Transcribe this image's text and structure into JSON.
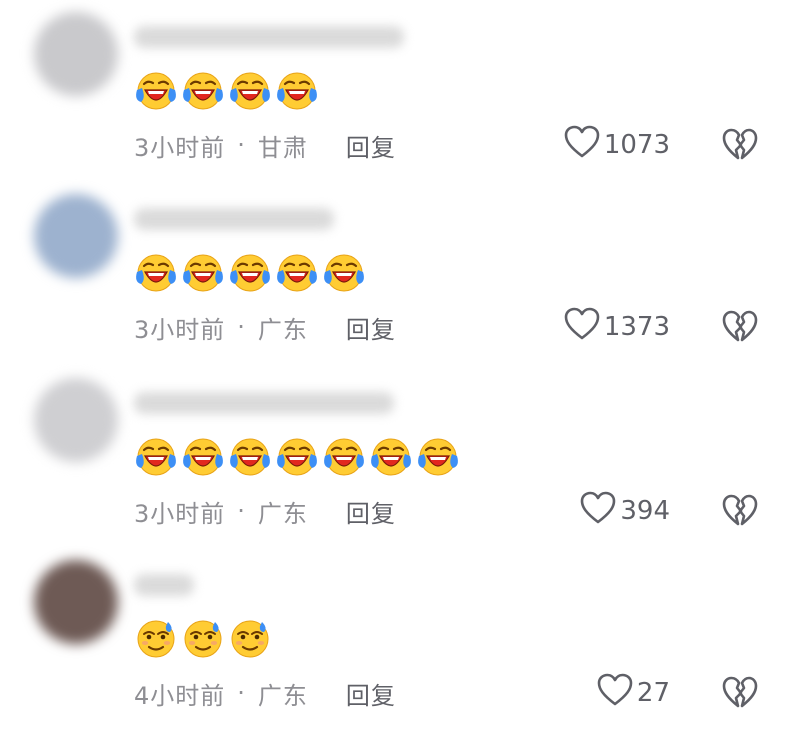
{
  "comments": [
    {
      "emoji": "crying-laughing-emoji",
      "emoji_count": 4,
      "time": "3小时前",
      "location": "甘肃",
      "reply_label": "回复",
      "like_count": "1073",
      "avatar_color": "#c9c9cc"
    },
    {
      "emoji": "crying-laughing-emoji",
      "emoji_count": 5,
      "time": "3小时前",
      "location": "广东",
      "reply_label": "回复",
      "like_count": "1373",
      "avatar_color": "#9db2cf"
    },
    {
      "emoji": "crying-laughing-emoji",
      "emoji_count": 7,
      "time": "3小时前",
      "location": "广东",
      "reply_label": "回复",
      "like_count": "394",
      "avatar_color": "#cfcfd2"
    },
    {
      "emoji": "sweating-smile-emoji",
      "emoji_count": 3,
      "time": "4小时前",
      "location": "广东",
      "reply_label": "回复",
      "like_count": "27",
      "avatar_color": "#6e5a55"
    }
  ],
  "separator": "·",
  "colors": {
    "meta_text": "#8e8e93",
    "action_text": "#5f6067",
    "emoji_face": "#ffcc33",
    "emoji_tear": "#3d8ff5"
  }
}
